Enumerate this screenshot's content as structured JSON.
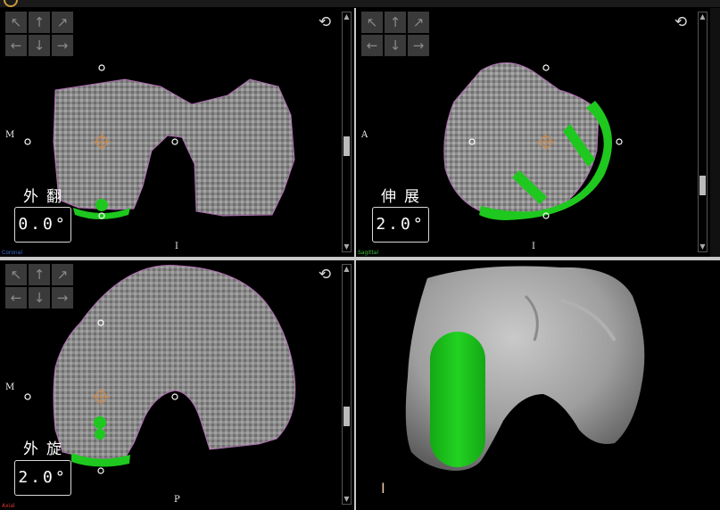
{
  "views": {
    "coronal": {
      "caption": "Coronal",
      "caption_color": "#3a6fd8",
      "left_label": "M",
      "bottom_label": "I",
      "control_label": "外翻",
      "angle": "0.0°",
      "scroll_level": 0.55
    },
    "sagittal": {
      "caption": "Sagittal",
      "caption_color": "#3fbf3f",
      "left_label": "A",
      "bottom_label": "I",
      "control_label": "伸展",
      "angle": "2.0°",
      "scroll_level": 0.7
    },
    "axial": {
      "caption": "Axial",
      "caption_color": "#d83a3a",
      "left_label": "M",
      "bottom_label": "P",
      "control_label": "外旋",
      "angle": "2.0°",
      "scroll_level": 0.62
    },
    "three_d": {
      "marker": "I"
    }
  },
  "nav_buttons": [
    "↖",
    "↑",
    "↗",
    "←",
    "↓",
    "→"
  ],
  "icons": {
    "rotate": "rotate-icon",
    "logo": "logo-icon"
  },
  "colors": {
    "implant": "#1ec81e",
    "contour": "#b06ab3",
    "bone3d": "#9a9a9a"
  }
}
